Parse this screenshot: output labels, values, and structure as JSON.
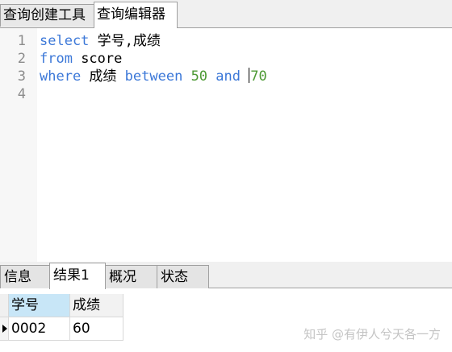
{
  "top_tabs": [
    "查询创建工具",
    "查询编辑器"
  ],
  "editor": {
    "line_numbers": [
      "1",
      "2",
      "3",
      "4"
    ],
    "line1": {
      "kw": "select",
      "rest": " 学号,成绩"
    },
    "line2": {
      "kw": "from",
      "rest": " score"
    },
    "line3": {
      "kw1": "where",
      "field": " 成绩 ",
      "kw2": "between",
      "n1": " 50",
      "kw3": " and ",
      "n2": "70"
    }
  },
  "bottom_tabs": [
    "信息",
    "结果1",
    "概况",
    "状态"
  ],
  "result": {
    "columns": [
      "学号",
      "成绩"
    ],
    "rows": [
      [
        "0002",
        "60"
      ]
    ]
  },
  "watermark": "知乎 @有伊人兮天各一方"
}
